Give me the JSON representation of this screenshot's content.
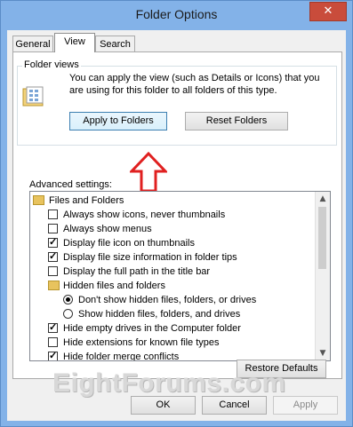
{
  "window": {
    "title": "Folder Options",
    "close_glyph": "✕"
  },
  "tabs": [
    {
      "label": "General",
      "active": false
    },
    {
      "label": "View",
      "active": true
    },
    {
      "label": "Search",
      "active": false
    }
  ],
  "folder_views": {
    "group_label": "Folder views",
    "description": "You can apply the view (such as Details or Icons) that you are using for this folder to all folders of this type.",
    "apply_button": "Apply to Folders",
    "reset_button": "Reset Folders"
  },
  "advanced": {
    "label": "Advanced settings:",
    "items": [
      {
        "type": "folder",
        "label": "Files and Folders"
      },
      {
        "type": "checkbox",
        "label": "Always show icons, never thumbnails",
        "checked": false
      },
      {
        "type": "checkbox",
        "label": "Always show menus",
        "checked": false
      },
      {
        "type": "checkbox",
        "label": "Display file icon on thumbnails",
        "checked": true
      },
      {
        "type": "checkbox",
        "label": "Display file size information in folder tips",
        "checked": true
      },
      {
        "type": "checkbox",
        "label": "Display the full path in the title bar",
        "checked": false
      },
      {
        "type": "folder",
        "label": "Hidden files and folders"
      },
      {
        "type": "radio",
        "label": "Don't show hidden files, folders, or drives",
        "selected": true
      },
      {
        "type": "radio",
        "label": "Show hidden files, folders, and drives",
        "selected": false
      },
      {
        "type": "checkbox",
        "label": "Hide empty drives in the Computer folder",
        "checked": true
      },
      {
        "type": "checkbox",
        "label": "Hide extensions for known file types",
        "checked": false
      },
      {
        "type": "checkbox",
        "label": "Hide folder merge conflicts",
        "checked": true
      }
    ]
  },
  "restore_button": "Restore Defaults",
  "watermark": "EightForums.com",
  "footer": {
    "ok": "OK",
    "cancel": "Cancel",
    "apply": "Apply"
  },
  "colors": {
    "frame": "#83b2e8",
    "close": "#c94c3b",
    "arrow": "#e02020"
  }
}
